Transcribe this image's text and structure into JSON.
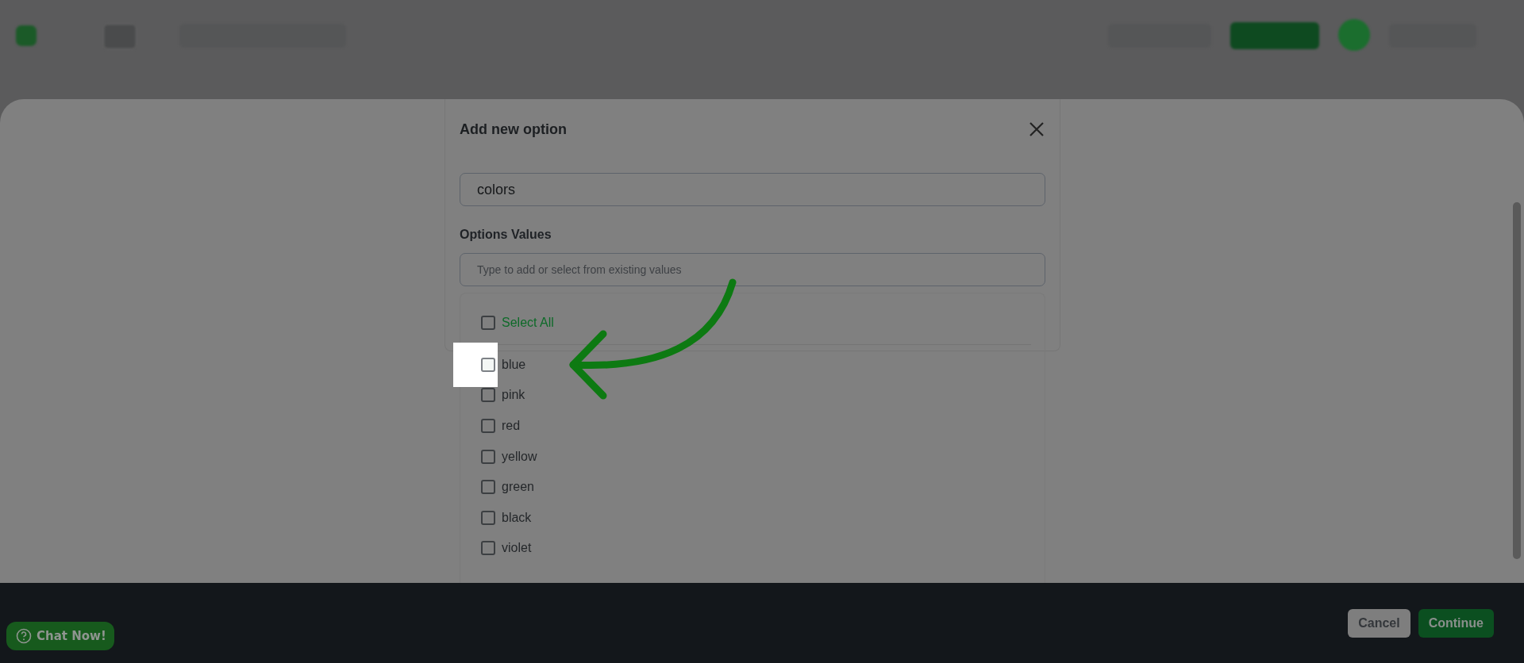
{
  "modal": {
    "title": "Add new option",
    "name_field": {
      "value": "colors"
    },
    "values_label": "Options Values",
    "values_field": {
      "placeholder": "Type to add or select from existing values"
    },
    "select_all": {
      "label": "Select All",
      "checked": false
    },
    "options": [
      {
        "label": "blue",
        "checked": false,
        "highlighted": true
      },
      {
        "label": "pink",
        "checked": false,
        "highlighted": false
      },
      {
        "label": "red",
        "checked": false,
        "highlighted": false
      },
      {
        "label": "yellow",
        "checked": false,
        "highlighted": false
      },
      {
        "label": "green",
        "checked": false,
        "highlighted": false
      },
      {
        "label": "black",
        "checked": false,
        "highlighted": false
      },
      {
        "label": "violet",
        "checked": false,
        "highlighted": false
      }
    ]
  },
  "footer": {
    "buttons": [
      {
        "label": "Cancel",
        "kind": "secondary"
      },
      {
        "label": "Continue",
        "kind": "primary"
      }
    ]
  },
  "chat_button": {
    "label": "Chat Now!"
  }
}
